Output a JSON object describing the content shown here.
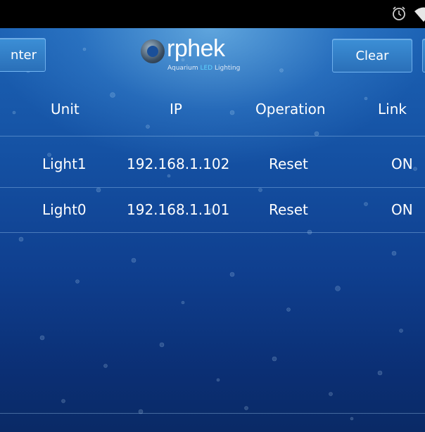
{
  "status_bar": {
    "icons": [
      "alarm-icon",
      "wifi-icon"
    ]
  },
  "header": {
    "left_button_label": "nter",
    "logo_text": "rphek",
    "logo_tagline_pre": "Aquarium ",
    "logo_tagline_led": "LED",
    "logo_tagline_post": " Lighting",
    "clear_button_label": "Clear"
  },
  "table": {
    "columns": [
      "Unit",
      "IP",
      "Operation",
      "Link"
    ],
    "rows": [
      {
        "unit": "Light1",
        "ip": "192.168.1.102",
        "operation": "Reset",
        "link": "ON"
      },
      {
        "unit": "Light0",
        "ip": "192.168.1.101",
        "operation": "Reset",
        "link": "ON"
      }
    ]
  },
  "colors": {
    "background_top": "#1c62b4",
    "background_bottom": "#0a2a66",
    "button": "#2a6fb8",
    "led_accent": "#5fd3ff"
  }
}
